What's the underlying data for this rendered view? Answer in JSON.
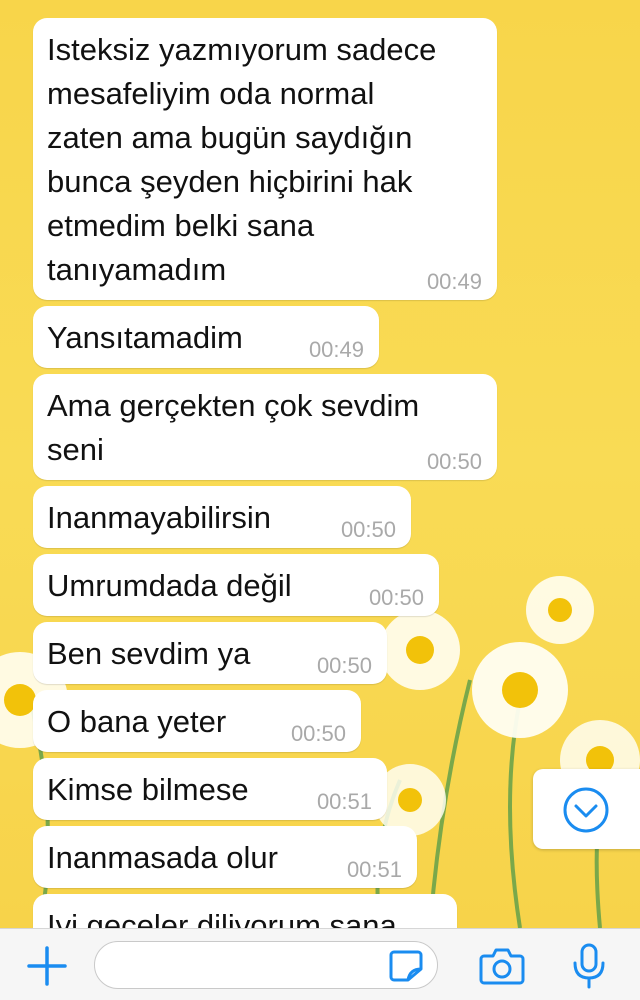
{
  "messages": [
    {
      "text": "Isteksiz yazmıyorum sadece\nmesafeliyim oda normal\nzaten ama bugün saydığın\nbunca şeyden hiçbirini hak\netmedim belki sana\ntanıyamadım",
      "time": "00:49"
    },
    {
      "text": "Yansıtamadim",
      "time": "00:49"
    },
    {
      "text": "Ama gerçekten çok sevdim\nseni",
      "time": "00:50"
    },
    {
      "text": "Inanmayabilirsin",
      "time": "00:50"
    },
    {
      "text": "Umrumdada değil",
      "time": "00:50"
    },
    {
      "text": "Ben sevdim ya",
      "time": "00:50"
    },
    {
      "text": "O bana yeter",
      "time": "00:50"
    },
    {
      "text": "Kimse bilmese",
      "time": "00:51"
    },
    {
      "text": "Inanmasada olur",
      "time": "00:51"
    },
    {
      "text": "Iyi geceler diliyorum sana",
      "time": ""
    }
  ],
  "input": {
    "placeholder": ""
  },
  "icons": {
    "scroll_down": "chevron-down-circle-icon",
    "plus": "plus-icon",
    "sticker": "sticker-icon",
    "camera": "camera-icon",
    "mic": "microphone-icon"
  },
  "colors": {
    "accent": "#1a8cf0",
    "wallpaper": "#f8d54a",
    "bubble": "#ffffff",
    "timestamp": "#a9a9a9"
  }
}
